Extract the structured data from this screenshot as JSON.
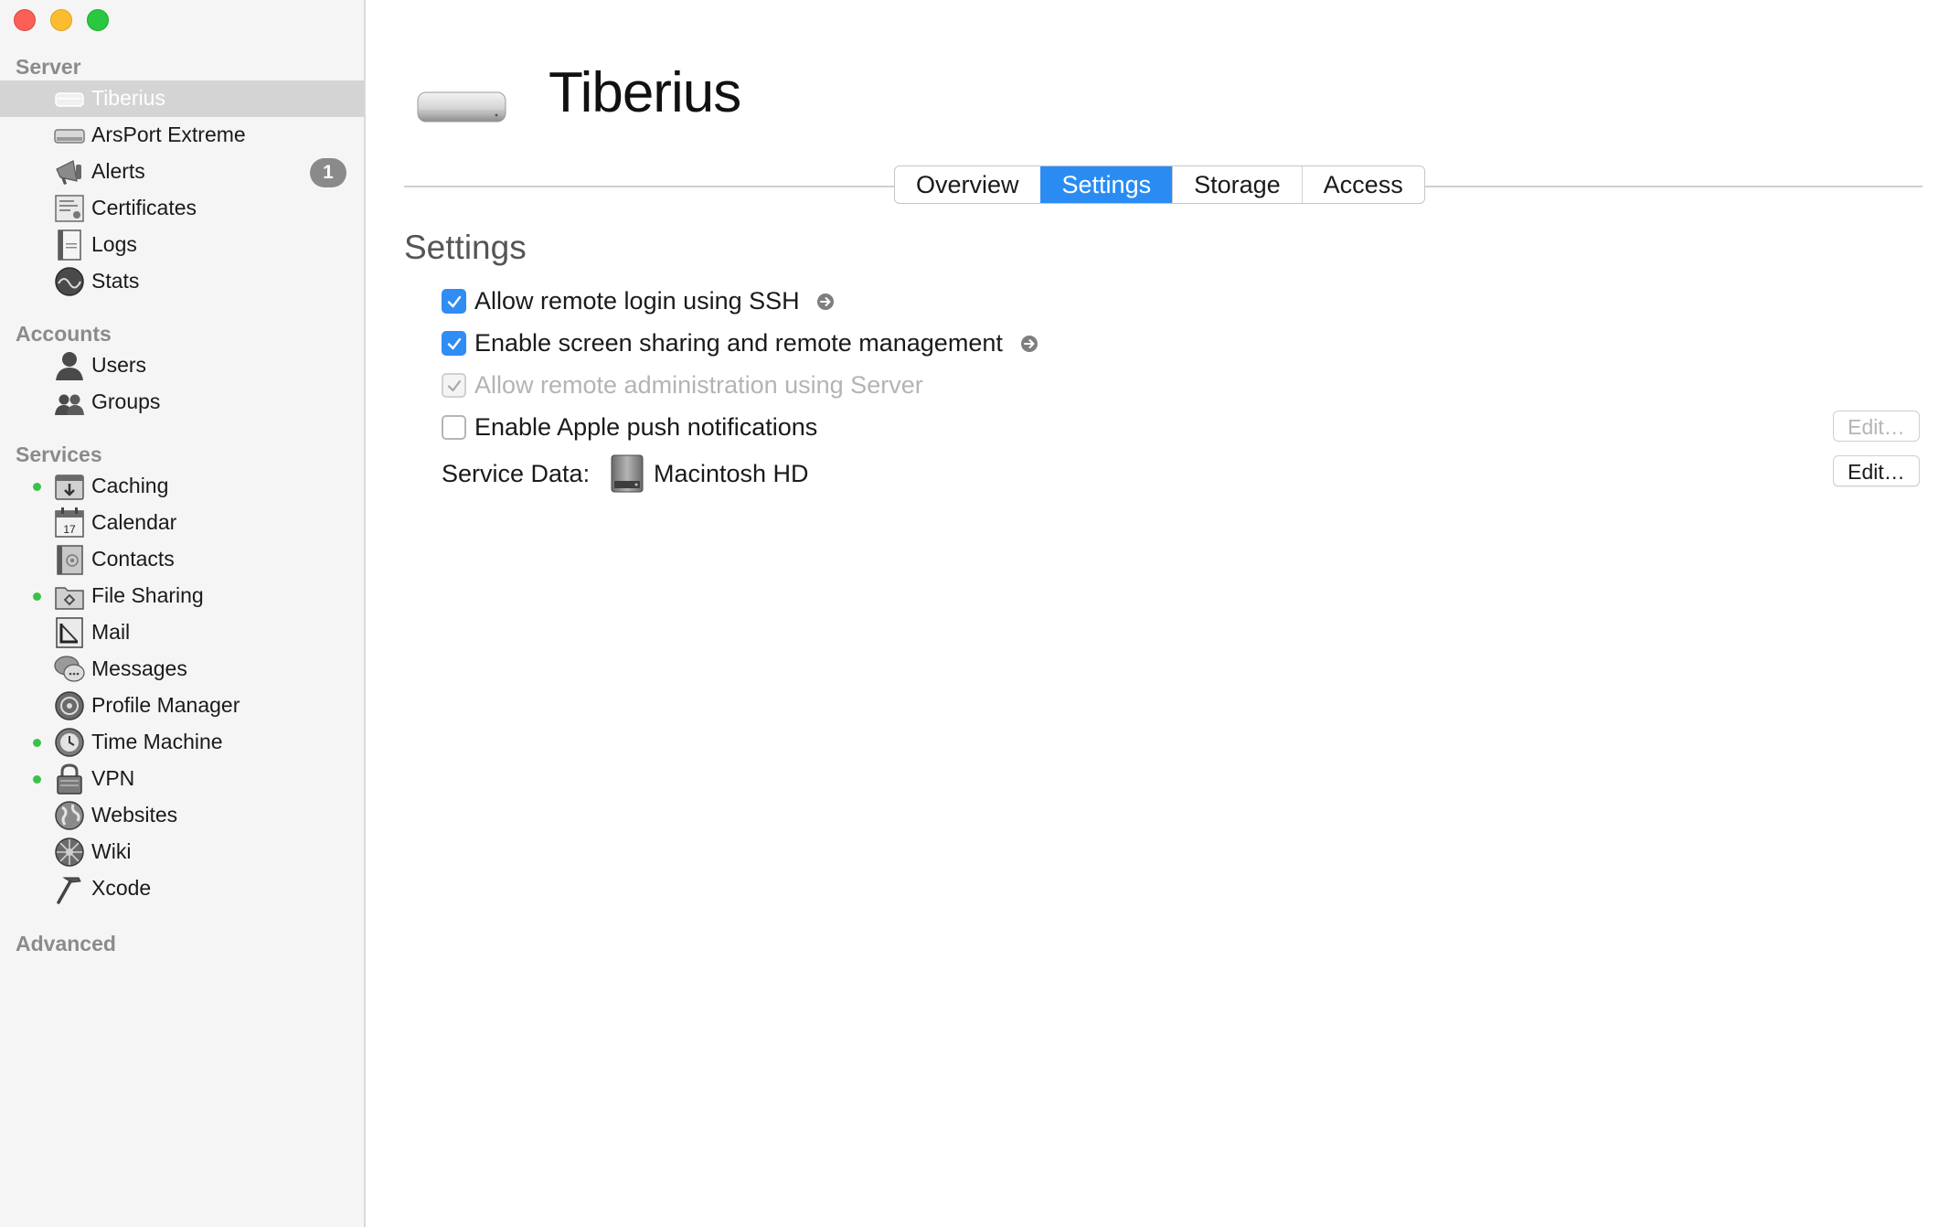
{
  "sidebar": {
    "sections": {
      "server": "Server",
      "accounts": "Accounts",
      "services": "Services",
      "advanced": "Advanced"
    },
    "server_items": [
      {
        "label": "Tiberius",
        "icon": "mac-mini-icon",
        "selected": true
      },
      {
        "label": "ArsPort Extreme",
        "icon": "airport-base-station-icon"
      },
      {
        "label": "Alerts",
        "icon": "megaphone-icon",
        "badge": "1"
      },
      {
        "label": "Certificates",
        "icon": "certificate-icon"
      },
      {
        "label": "Logs",
        "icon": "log-document-icon"
      },
      {
        "label": "Stats",
        "icon": "stats-gauge-icon"
      }
    ],
    "account_items": [
      {
        "label": "Users",
        "icon": "user-icon"
      },
      {
        "label": "Groups",
        "icon": "group-icon"
      }
    ],
    "service_items": [
      {
        "label": "Caching",
        "icon": "caching-icon",
        "running": true
      },
      {
        "label": "Calendar",
        "icon": "calendar-icon",
        "day": "17"
      },
      {
        "label": "Contacts",
        "icon": "contacts-icon"
      },
      {
        "label": "File Sharing",
        "icon": "file-sharing-icon",
        "running": true
      },
      {
        "label": "Mail",
        "icon": "mail-icon"
      },
      {
        "label": "Messages",
        "icon": "messages-icon"
      },
      {
        "label": "Profile Manager",
        "icon": "profile-manager-icon"
      },
      {
        "label": "Time Machine",
        "icon": "time-machine-icon",
        "running": true
      },
      {
        "label": "VPN",
        "icon": "vpn-lock-icon",
        "running": true
      },
      {
        "label": "Websites",
        "icon": "globe-icon"
      },
      {
        "label": "Wiki",
        "icon": "wiki-icon"
      },
      {
        "label": "Xcode",
        "icon": "hammer-icon"
      }
    ]
  },
  "header": {
    "server_name": "Tiberius",
    "icon": "mac-mini-icon"
  },
  "tabs": [
    {
      "label": "Overview",
      "active": false
    },
    {
      "label": "Settings",
      "active": true
    },
    {
      "label": "Storage",
      "active": false
    },
    {
      "label": "Access",
      "active": false
    }
  ],
  "settings": {
    "title": "Settings",
    "options": [
      {
        "label": "Allow remote login using SSH",
        "checked": true,
        "enabled": true,
        "has_arrow": true
      },
      {
        "label": "Enable screen sharing and remote management",
        "checked": true,
        "enabled": true,
        "has_arrow": true
      },
      {
        "label": "Allow remote administration using Server",
        "checked": true,
        "enabled": false,
        "has_arrow": false
      },
      {
        "label": "Enable Apple push notifications",
        "checked": false,
        "enabled": true,
        "has_arrow": false
      }
    ],
    "push_edit_label": "Edit…",
    "service_data_label": "Service Data:",
    "service_data_volume": "Macintosh HD",
    "service_data_edit_label": "Edit…"
  },
  "colors": {
    "accent": "#2a8cf3",
    "running_dot": "#39c24a",
    "sidebar_bg": "#f5f5f5",
    "selection": "#d4d4d4"
  }
}
